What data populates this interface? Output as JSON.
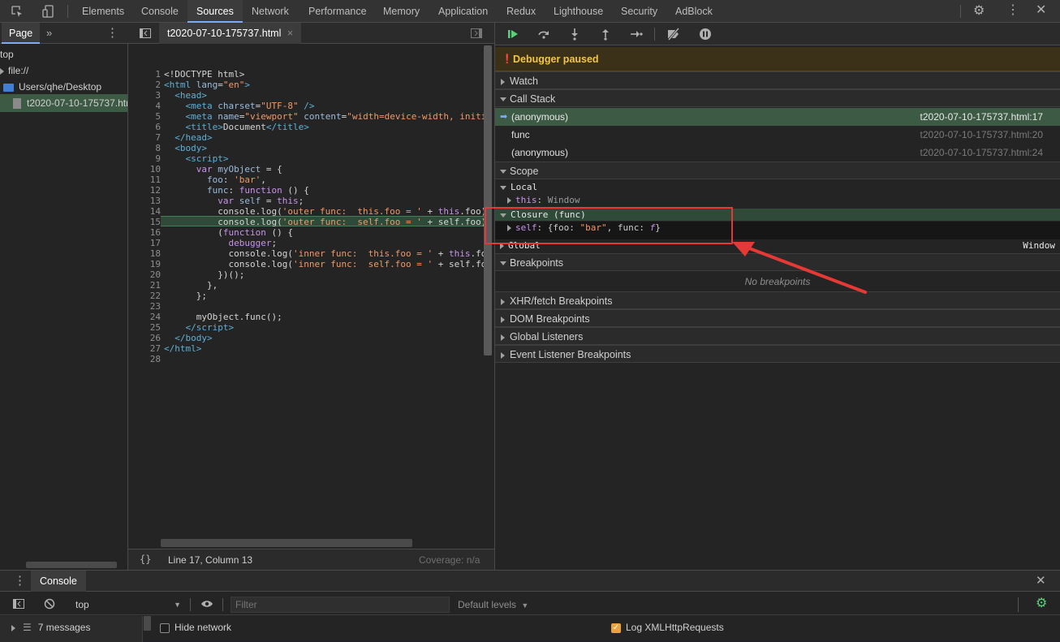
{
  "devtools_tabs": [
    "Elements",
    "Console",
    "Sources",
    "Network",
    "Performance",
    "Memory",
    "Application",
    "Redux",
    "Lighthouse",
    "Security",
    "AdBlock"
  ],
  "active_tab": "Sources",
  "navigator": {
    "tab_label": "Page",
    "tree": [
      "top",
      "file://",
      "Users/qhe/Desktop",
      "t2020-07-10-175737.html"
    ]
  },
  "editor": {
    "file_tab": "t2020-07-10-175737.html",
    "status": "Line 17, Column 13",
    "coverage": "Coverage: n/a",
    "current_line": 17,
    "line_count": 28
  },
  "debugger": {
    "paused_message": "Debugger paused",
    "watch_label": "Watch",
    "call_stack_label": "Call Stack",
    "call_stack": [
      {
        "name": "(anonymous)",
        "location": "t2020-07-10-175737.html:17",
        "active": true
      },
      {
        "name": "func",
        "location": "t2020-07-10-175737.html:20",
        "active": false
      },
      {
        "name": "(anonymous)",
        "location": "t2020-07-10-175737.html:24",
        "active": false
      }
    ],
    "scope_label": "Scope",
    "local_label": "Local",
    "local_this_key": "this",
    "local_this_value": "Window",
    "closure_label": "Closure (func)",
    "closure_self_key": "self",
    "closure_self_value_prefix": "{foo: ",
    "closure_self_value_string": "\"bar\"",
    "closure_self_value_mid": ", func: ",
    "closure_self_value_fn": "f",
    "closure_self_value_suffix": "}",
    "global_label": "Global",
    "global_value": "Window",
    "breakpoints_label": "Breakpoints",
    "no_breakpoints": "No breakpoints",
    "sections": [
      "XHR/fetch Breakpoints",
      "DOM Breakpoints",
      "Global Listeners",
      "Event Listener Breakpoints"
    ]
  },
  "console": {
    "title": "Console",
    "context": "top",
    "filter_placeholder": "Filter",
    "levels": "Default levels",
    "messages": "7 messages",
    "hide_network": "Hide network",
    "log_xhr": "Log XMLHttpRequests"
  },
  "colors": {
    "accent": "#7cacf8",
    "highlight_line": "#2f4a38",
    "annotation": "#e53935",
    "paused": "#f5c542"
  }
}
